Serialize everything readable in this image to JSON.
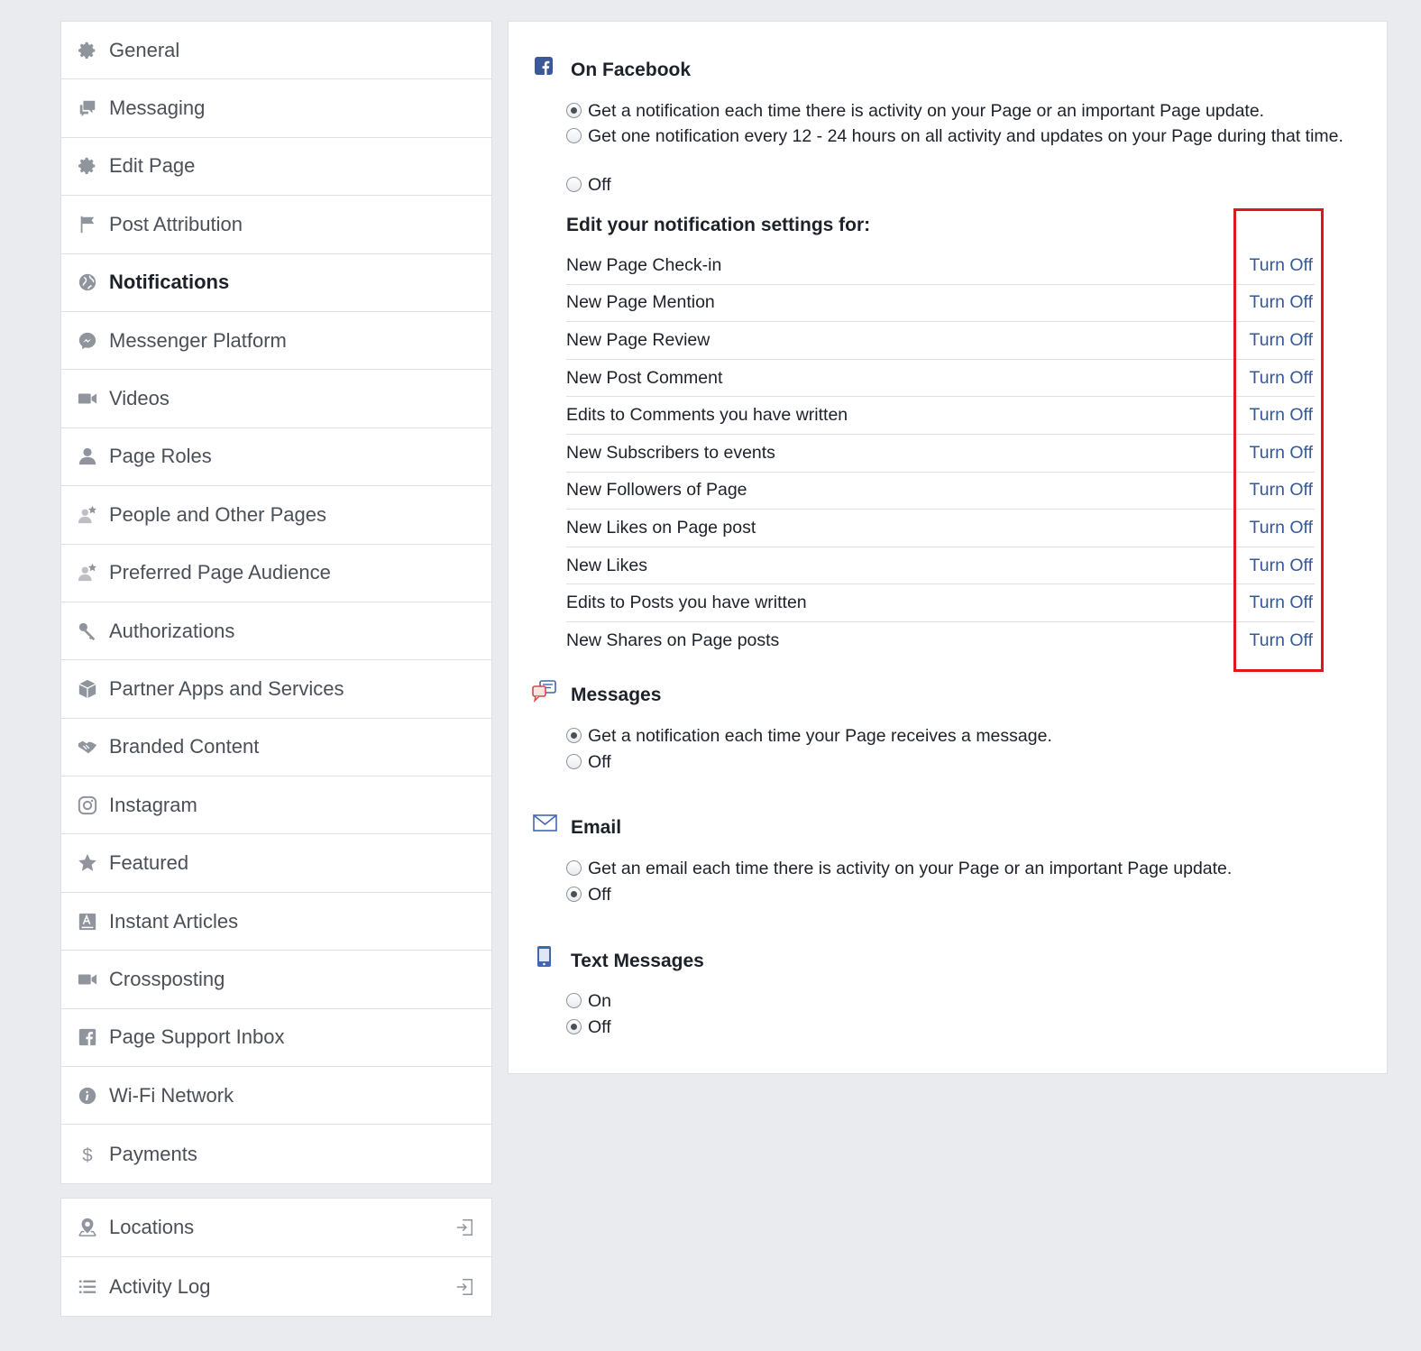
{
  "sidebar": {
    "items": [
      {
        "label": "General",
        "icon": "gear-icon"
      },
      {
        "label": "Messaging",
        "icon": "chat-icon"
      },
      {
        "label": "Edit Page",
        "icon": "gear-icon"
      },
      {
        "label": "Post Attribution",
        "icon": "flag-icon"
      },
      {
        "label": "Notifications",
        "icon": "globe-icon",
        "active": true
      },
      {
        "label": "Messenger Platform",
        "icon": "messenger-icon"
      },
      {
        "label": "Videos",
        "icon": "video-icon"
      },
      {
        "label": "Page Roles",
        "icon": "person-icon"
      },
      {
        "label": "People and Other Pages",
        "icon": "person-star-icon"
      },
      {
        "label": "Preferred Page Audience",
        "icon": "person-star-icon"
      },
      {
        "label": "Authorizations",
        "icon": "key-icon"
      },
      {
        "label": "Partner Apps and Services",
        "icon": "cube-icon"
      },
      {
        "label": "Branded Content",
        "icon": "handshake-icon"
      },
      {
        "label": "Instagram",
        "icon": "instagram-icon"
      },
      {
        "label": "Featured",
        "icon": "star-icon"
      },
      {
        "label": "Instant Articles",
        "icon": "article-icon"
      },
      {
        "label": "Crossposting",
        "icon": "video-icon"
      },
      {
        "label": "Page Support Inbox",
        "icon": "facebook-icon"
      },
      {
        "label": "Wi-Fi Network",
        "icon": "info-icon"
      },
      {
        "label": "Payments",
        "icon": "dollar-icon"
      }
    ],
    "secondary": [
      {
        "label": "Locations",
        "icon": "location-icon"
      },
      {
        "label": "Activity Log",
        "icon": "list-icon"
      }
    ]
  },
  "on_facebook": {
    "title": "On Facebook",
    "options": [
      {
        "label": "Get a notification each time there is activity on your Page or an important Page update.",
        "checked": true
      },
      {
        "label": "Get one notification every 12 - 24 hours on all activity and updates on your Page during that time.",
        "checked": false
      },
      {
        "label": "Off",
        "checked": false
      }
    ],
    "edit_heading": "Edit your notification settings for:",
    "action_label": "Turn Off",
    "notifications": [
      "New Page Check-in",
      "New Page Mention",
      "New Page Review",
      "New Post Comment",
      "Edits to Comments you have written",
      "New Subscribers to events",
      "New Followers of Page",
      "New Likes on Page post",
      "New Likes",
      "Edits to Posts you have written",
      "New Shares on Page posts"
    ]
  },
  "messages": {
    "title": "Messages",
    "options": [
      {
        "label": "Get a notification each time your Page receives a message.",
        "checked": true
      },
      {
        "label": "Off",
        "checked": false
      }
    ]
  },
  "email": {
    "title": "Email",
    "options": [
      {
        "label": "Get an email each time there is activity on your Page or an important Page update.",
        "checked": false
      },
      {
        "label": "Off",
        "checked": true
      }
    ]
  },
  "text_messages": {
    "title": "Text Messages",
    "options": [
      {
        "label": "On",
        "checked": false
      },
      {
        "label": "Off",
        "checked": true
      }
    ]
  },
  "colors": {
    "link": "#365899",
    "highlight": "#e0161d",
    "background": "#e9ebee"
  }
}
